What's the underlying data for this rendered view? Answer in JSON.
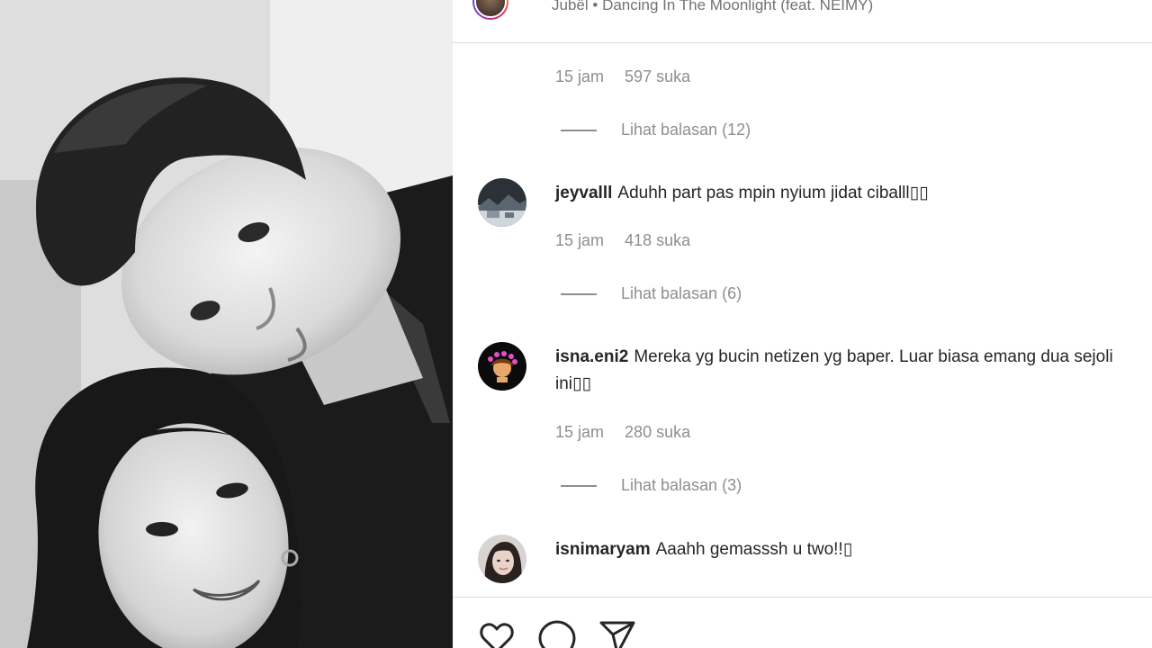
{
  "header": {
    "audio_artist": "Jubël",
    "audio_separator": "•",
    "audio_title": "Dancing In The Moonlight (feat. NEIMY)"
  },
  "first_comment_meta": {
    "time": "15 jam",
    "likes": "597 suka",
    "replies": "Lihat balasan (12)"
  },
  "comments": [
    {
      "username": "jeyvalll",
      "text": "Aduhh part pas mpin nyium jidat ciballl▯▯",
      "time": "15 jam",
      "likes": "418 suka",
      "replies": "Lihat balasan (6)"
    },
    {
      "username": "isna.eni2",
      "text": "Mereka yg bucin netizen yg baper. Luar biasa emang dua sejoli ini▯▯",
      "time": "15 jam",
      "likes": "280 suka",
      "replies": "Lihat balasan (3)"
    },
    {
      "username": "isnimaryam",
      "text": "Aaahh gemasssh u two!!▯"
    }
  ],
  "icons": {
    "like": "heart-icon",
    "comment": "comment-icon",
    "share": "send-icon"
  }
}
